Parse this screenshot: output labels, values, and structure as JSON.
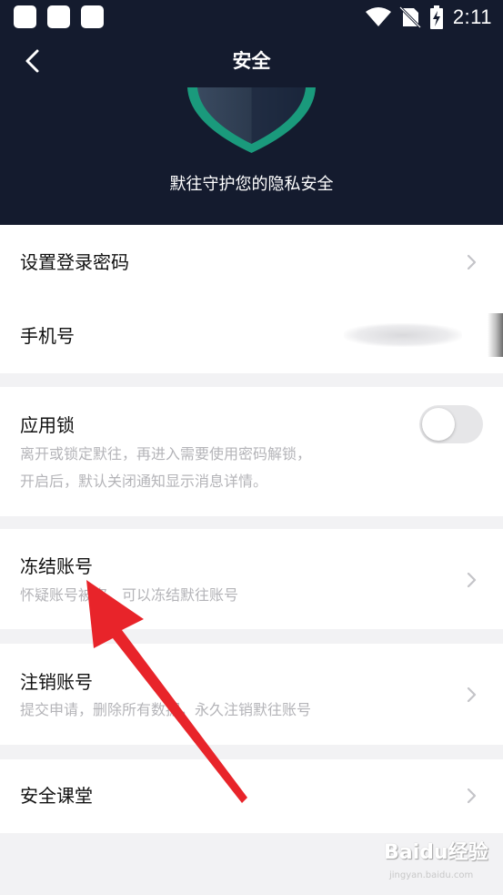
{
  "status_bar": {
    "time": "2:11",
    "icons": [
      "notification-square",
      "notification-square",
      "notification-square",
      "wifi-icon",
      "no-sim-icon",
      "battery-charging-icon"
    ]
  },
  "header": {
    "back_icon": "back-chevron-icon",
    "title": "安全",
    "shield_icon": "shield-icon",
    "subtitle": "默往守护您的隐私安全",
    "colors": {
      "background": "#141b2e",
      "shield_green": "#1a9a7c"
    }
  },
  "settings": {
    "login_password": {
      "title": "设置登录密码"
    },
    "phone": {
      "title": "手机号"
    },
    "app_lock": {
      "title": "应用锁",
      "description_line1": "离开或锁定默往，再进入需要使用密码解锁，",
      "description_line2": "开启后，默认关闭通知显示消息详情。",
      "toggle_on": false
    },
    "freeze_account": {
      "title": "冻结账号",
      "description": "怀疑账号被盗，可以冻结默往账号"
    },
    "cancel_account": {
      "title": "注销账号",
      "description": "提交申请，删除所有数据，永久注销默往账号"
    },
    "security_class": {
      "title": "安全课堂"
    }
  },
  "annotation": {
    "arrow_color": "#e8242a"
  },
  "watermark": {
    "main": "Baidu经验",
    "sub": "jingyan.baidu.com"
  }
}
